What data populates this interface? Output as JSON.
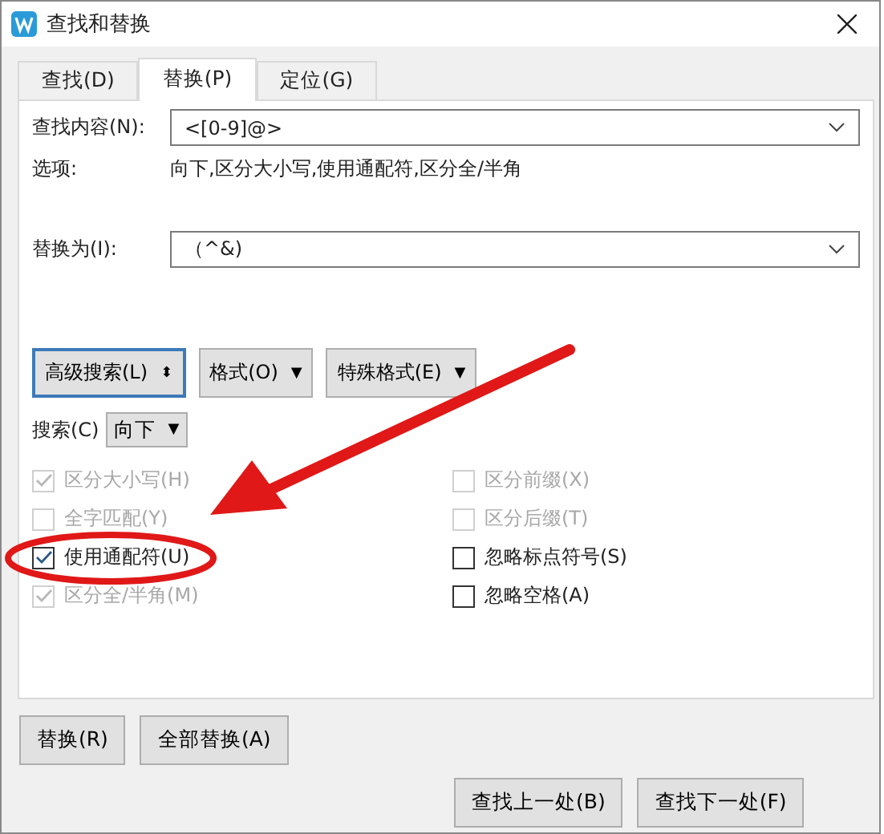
{
  "window": {
    "title": "查找和替换"
  },
  "tabs": [
    {
      "label": "查找(D)",
      "selected": false
    },
    {
      "label": "替换(P)",
      "selected": true
    },
    {
      "label": "定位(G)",
      "selected": false
    }
  ],
  "find": {
    "label": "查找内容(N):",
    "value": "<[0-9]@>"
  },
  "options": {
    "label": "选项:",
    "value": "向下,区分大小写,使用通配符,区分全/半角"
  },
  "replace": {
    "label": "替换为(I):",
    "value": "（^&)"
  },
  "tool_buttons": [
    {
      "label": "高级搜索(L)",
      "glyph": "⬍",
      "focused": true
    },
    {
      "label": "格式(O)",
      "glyph": "▼",
      "focused": false
    },
    {
      "label": "特殊格式(E)",
      "glyph": "▼",
      "focused": false
    }
  ],
  "search": {
    "label": "搜索(C)",
    "value": "向下",
    "glyph": "▼"
  },
  "checkboxes_left": [
    {
      "label": "区分大小写(H)",
      "checked": true,
      "disabled": true
    },
    {
      "label": "全字匹配(Y)",
      "checked": false,
      "disabled": true
    },
    {
      "label": "使用通配符(U)",
      "checked": true,
      "disabled": false
    },
    {
      "label": "区分全/半角(M)",
      "checked": true,
      "disabled": true
    }
  ],
  "checkboxes_right": [
    {
      "label": "区分前缀(X)",
      "checked": false,
      "disabled": true
    },
    {
      "label": "区分后缀(T)",
      "checked": false,
      "disabled": true
    },
    {
      "label": "忽略标点符号(S)",
      "checked": false,
      "disabled": false
    },
    {
      "label": "忽略空格(A)",
      "checked": false,
      "disabled": false
    }
  ],
  "action_buttons": [
    "替换(R)",
    "全部替换(A)"
  ],
  "nav_buttons": [
    "查找上一处(B)",
    "查找下一处(F)"
  ]
}
